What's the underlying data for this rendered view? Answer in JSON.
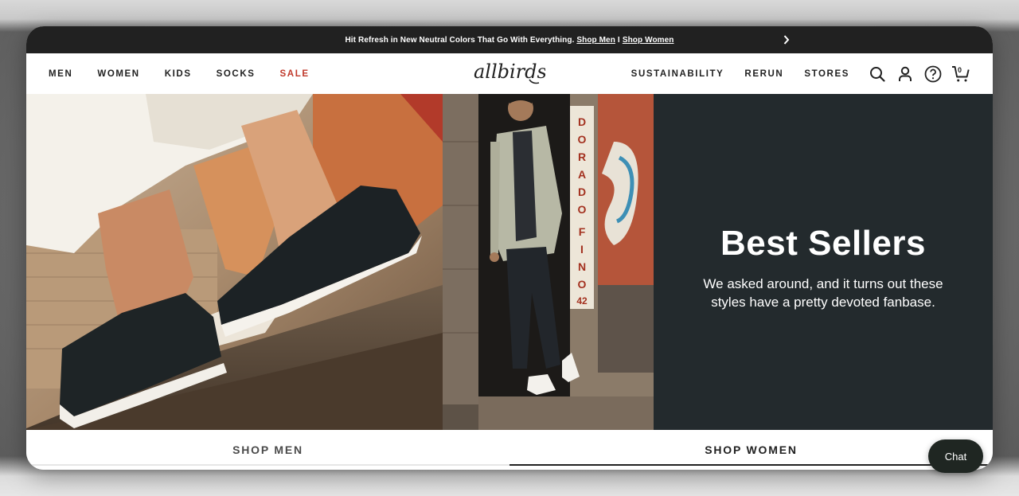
{
  "announcement": {
    "text": "Hit Refresh in New Neutral Colors That Go With Everything.",
    "link_men": "Shop Men",
    "separator": "I",
    "link_women": "Shop Women"
  },
  "nav": {
    "left": [
      "MEN",
      "WOMEN",
      "KIDS",
      "SOCKS",
      "SALE"
    ],
    "right": [
      "SUSTAINABILITY",
      "RERUN",
      "STORES"
    ],
    "logo": "allbirds",
    "cart_count": "0",
    "icons": [
      "search-icon",
      "account-icon",
      "help-icon",
      "cart-icon"
    ]
  },
  "hero": {
    "title": "Best Sellers",
    "subtitle": "We asked around, and it turns out these styles have a pretty devoted fanbase.",
    "sign_text": "DORADO FINO 42",
    "bg_color": "#232a2d"
  },
  "tabs": {
    "men": "SHOP MEN",
    "women": "SHOP WOMEN",
    "active": "women"
  },
  "chat": {
    "label": "Chat"
  },
  "colors": {
    "announcement_bg": "#212121",
    "sale": "#c0392b",
    "promo_bg": "#232a2d"
  }
}
